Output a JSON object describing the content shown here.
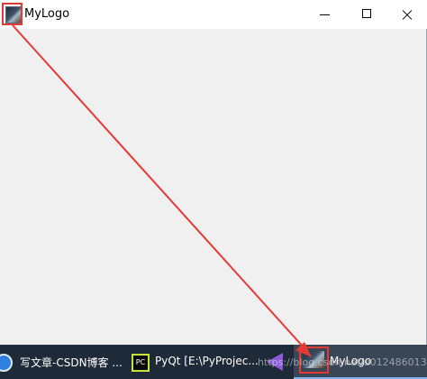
{
  "window": {
    "title": "MyLogo",
    "icon": "mylogo-app-icon",
    "controls": {
      "minimize": "minimize-icon",
      "maximize": "maximize-icon",
      "close": "close-icon"
    }
  },
  "taskbar": {
    "items": [
      {
        "label": "写文章-CSDN博客 ...",
        "icon": "csdn-browser-icon"
      },
      {
        "label": "PyQt [E:\\PyProjec...",
        "icon": "pycharm-icon",
        "icon_text": "PC"
      },
      {
        "label": "",
        "icon": "visual-studio-icon"
      },
      {
        "label": "MyLogo",
        "icon": "mylogo-app-icon"
      }
    ]
  },
  "watermark": "https://blog.csdn.net/u012486013",
  "annotation": {
    "color": "#e53935"
  }
}
